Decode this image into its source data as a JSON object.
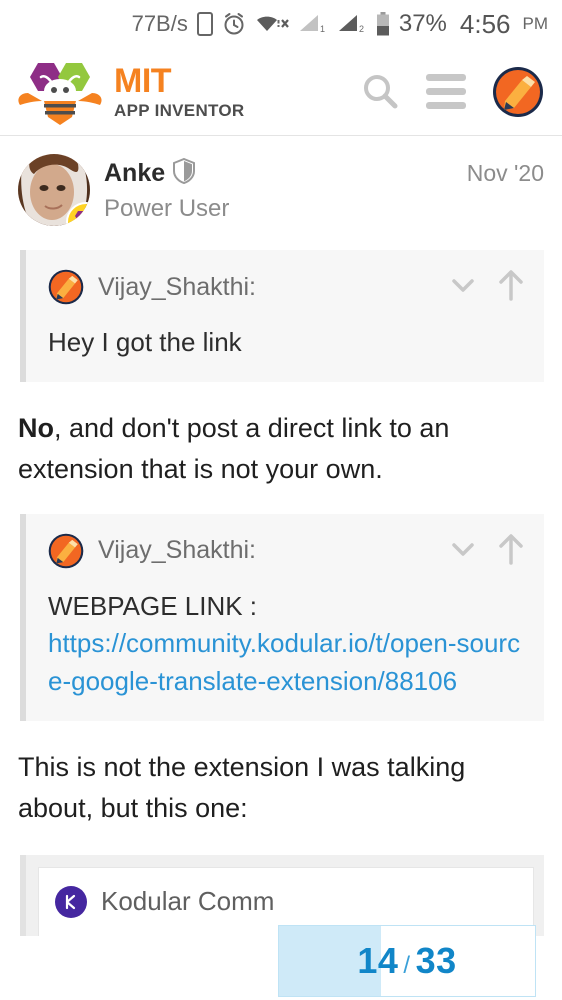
{
  "status_bar": {
    "network_speed": "77B/s",
    "battery_percent": "37%",
    "time": "4:56",
    "ampm": "PM",
    "icons": [
      "phone-icon",
      "alarm-clock-icon",
      "wifi-off-icon",
      "signal-1-icon",
      "signal-2-icon",
      "battery-icon"
    ]
  },
  "header": {
    "brand_top": "MIT",
    "brand_bottom": "APP INVENTOR",
    "search_icon": "search-icon",
    "menu_icon": "hamburger-menu-icon",
    "avatar_icon": "user-avatar-pencil-icon",
    "brand_orange": "#f58220",
    "brand_gray": "#4d4d4d"
  },
  "post": {
    "author": "Anke",
    "author_badge_icon": "shield-icon",
    "author_title": "Power User",
    "date": "Nov '20",
    "avatar_icon": "profile-photo-avatar",
    "flair_icon": "app-inventor-bee-badge"
  },
  "quotes": [
    {
      "avatar_icon": "user-avatar-pencil-icon",
      "username": "Vijay_Shakthi:",
      "expand_icon": "chevron-down-icon",
      "jump_icon": "arrow-up-icon",
      "text": "Hey I got the link",
      "link": null,
      "link_label": null
    },
    {
      "avatar_icon": "user-avatar-pencil-icon",
      "username": "Vijay_Shakthi:",
      "expand_icon": "chevron-down-icon",
      "jump_icon": "arrow-up-icon",
      "text": "WEBPAGE LINK : ",
      "link": "https://community.kodular.io/t/open-source-google-translate-extension/88106",
      "link_label": "https://community.kodular.io/t/open-source-google-translate-extension/88106"
    }
  ],
  "paragraphs": [
    {
      "lead_bold": "No",
      "rest": ", and don't post a direct link to an extension that is not your own."
    },
    {
      "lead_bold": "",
      "rest": "This is not the extension I was talking about, but this one:"
    }
  ],
  "link_card": {
    "icon": "kodular-community-icon",
    "title": "Kodular Comm",
    "icon_color": "#4527a0"
  },
  "pager": {
    "current": "14",
    "separator": "/",
    "total": "33",
    "fill_percent": 40,
    "fill_color": "#cfeaf8",
    "text_color": "#1186c8"
  }
}
